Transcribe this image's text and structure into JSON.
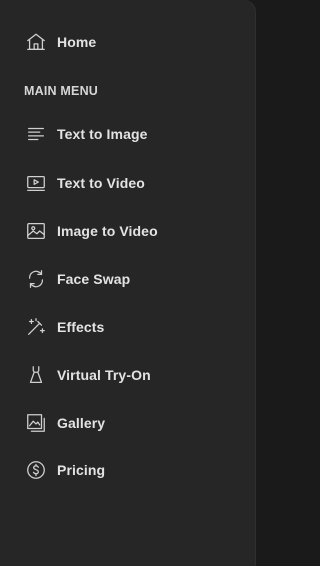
{
  "sidebar": {
    "home": {
      "label": "Home",
      "icon": "home-icon"
    },
    "section_title": "MAIN MENU",
    "items": [
      {
        "label": "Text to Image",
        "icon": "text-lines-icon"
      },
      {
        "label": "Text to Video",
        "icon": "play-screen-icon"
      },
      {
        "label": "Image to Video",
        "icon": "image-icon"
      },
      {
        "label": "Face Swap",
        "icon": "swap-arrows-icon"
      },
      {
        "label": "Effects",
        "icon": "magic-wand-icon"
      },
      {
        "label": "Virtual Try-On",
        "icon": "dress-icon"
      },
      {
        "label": "Gallery",
        "icon": "gallery-icon"
      },
      {
        "label": "Pricing",
        "icon": "dollar-circle-icon"
      }
    ]
  },
  "colors": {
    "background": "#262626",
    "text": "#e3e3e3",
    "icon": "#cfcfcf"
  }
}
